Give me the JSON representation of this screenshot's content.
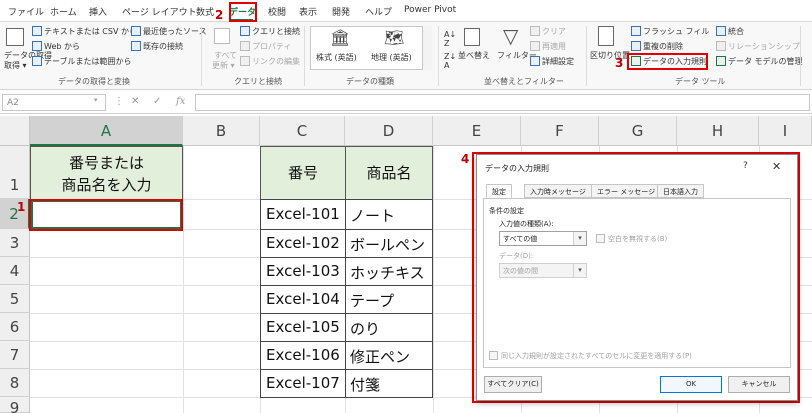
{
  "ribbon_tabs": [
    "ファイル",
    "ホーム",
    "挿入",
    "ページ レイアウト",
    "数式",
    "データ",
    "校閲",
    "表示",
    "開発",
    "ヘルプ",
    "Power Pivot"
  ],
  "active_tab": "データ",
  "ribbon": {
    "get_data": "データの取得",
    "get_data_sub": "取得 ▾",
    "from_text_csv": "テキストまたは CSV から",
    "from_web": "Web から",
    "from_table": "テーブルまたは範囲から",
    "recent_sources": "最近使ったソース",
    "existing_connections": "既存の接続",
    "group_get_transform": "データの取得と変換",
    "refresh_all": "すべて",
    "refresh_all_sub": "更新 ▾",
    "queries_connections": "クエリと接続",
    "properties": "プロパティ",
    "edit_links": "リンクの編集",
    "group_queries": "クエリと接続",
    "stocks": "株式 (英語)",
    "geography": "地理 (英語)",
    "group_data_types": "データの種類",
    "sort": "並べ替え",
    "filter": "フィルター",
    "clear": "クリア",
    "reapply": "再適用",
    "advanced": "詳細設定",
    "group_sort_filter": "並べ替えとフィルター",
    "text_to_columns": "区切り位置",
    "flash_fill": "フラッシュ フィル",
    "remove_duplicates": "重複の削除",
    "data_validation": "データの入力規則",
    "consolidate": "統合",
    "relationships": "リレーションシップ",
    "data_model": "データ モデルの管理",
    "group_data_tools": "データ ツール"
  },
  "formula_bar": {
    "name_box": "A2",
    "fx": "fx"
  },
  "grid": {
    "columns": [
      "A",
      "B",
      "C",
      "D",
      "E",
      "F",
      "G",
      "H",
      "I"
    ],
    "rows": [
      "1",
      "2",
      "3",
      "4",
      "5",
      "6",
      "7",
      "8",
      "9"
    ],
    "a1_line1": "番号または",
    "a1_line2": "商品名を入力",
    "c1": "番号",
    "d1": "商品名",
    "table": [
      [
        "Excel-101",
        "ノート"
      ],
      [
        "Excel-102",
        "ボールペン"
      ],
      [
        "Excel-103",
        "ホッチキス"
      ],
      [
        "Excel-104",
        "テープ"
      ],
      [
        "Excel-105",
        "のり"
      ],
      [
        "Excel-106",
        "修正ペン"
      ],
      [
        "Excel-107",
        "付箋"
      ]
    ]
  },
  "callouts": [
    "1",
    "2",
    "3",
    "4"
  ],
  "dialog": {
    "title": "データの入力規則",
    "help": "?",
    "close": "✕",
    "tabs": [
      "設定",
      "入力時メッセージ",
      "エラー メッセージ",
      "日本語入力"
    ],
    "section": "条件の設定",
    "allow_label": "入力値の種類(A):",
    "allow_value": "すべての値",
    "ignore_blank": "空白を無視する(B)",
    "data_label": "データ(D):",
    "data_value": "次の値の間",
    "apply_all": "同じ入力規則が設定されたすべてのセルに変更を適用する(P)",
    "clear_all": "すべてクリア(C)",
    "ok": "OK",
    "cancel": "キャンセル"
  },
  "colors": {
    "excel_green": "#217346",
    "highlight_red": "#e00000",
    "header_fill": "#e2efda"
  }
}
